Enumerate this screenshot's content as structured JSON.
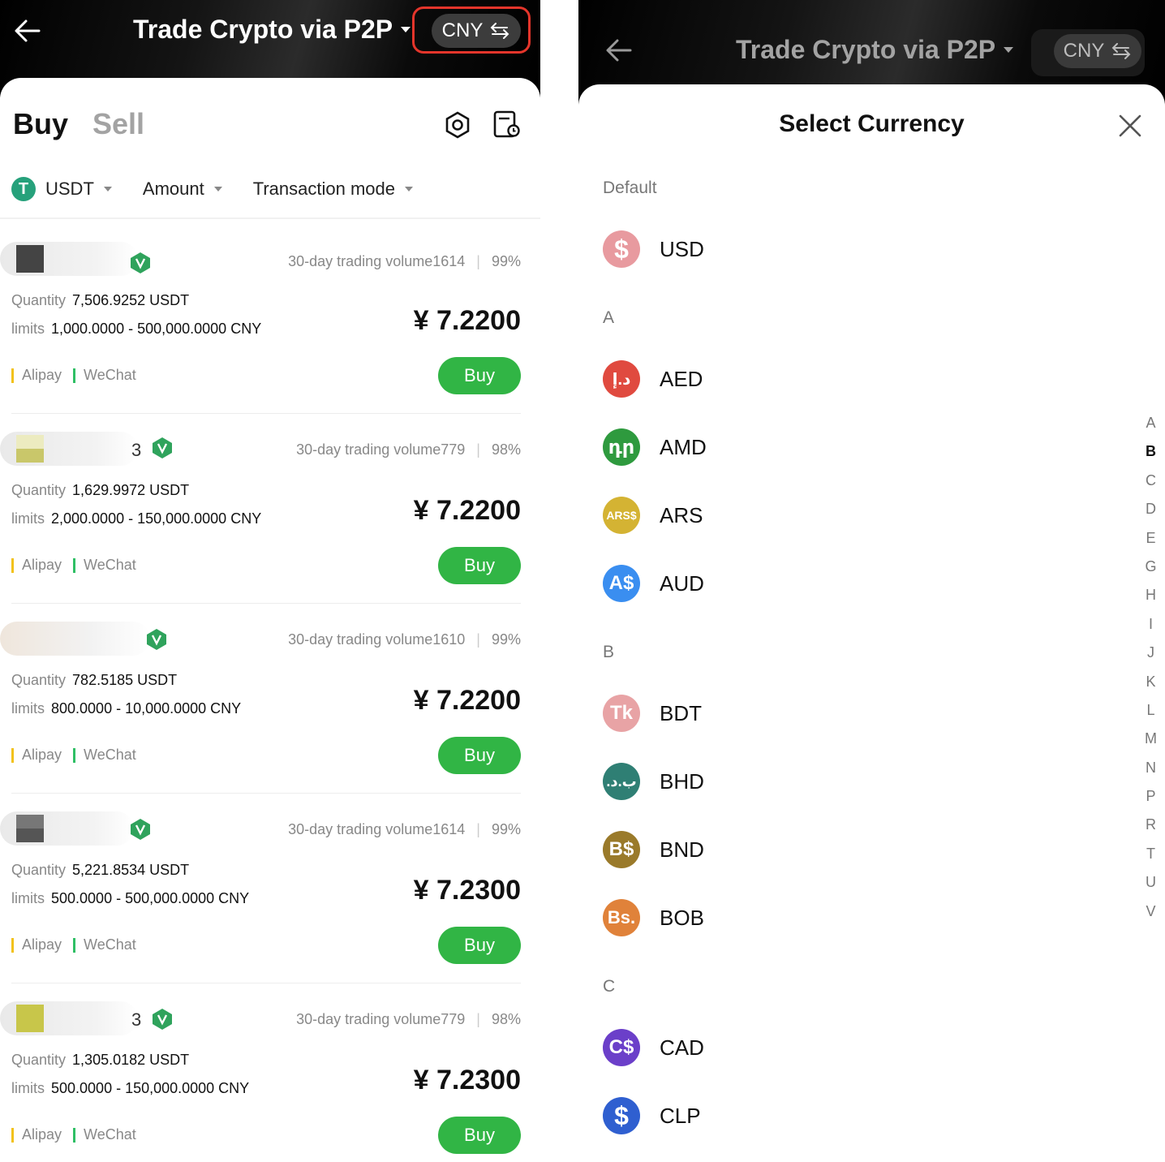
{
  "left": {
    "header": {
      "title": "Trade Crypto via P2P",
      "currency": "CNY"
    },
    "tabs": {
      "buy": "Buy",
      "sell": "Sell"
    },
    "filters": {
      "asset": "USDT",
      "amount": "Amount",
      "mode": "Transaction mode"
    },
    "offers": [
      {
        "avatar_color": "#444444",
        "initial": "",
        "volume": "30-day trading volume1614",
        "rate": "99%",
        "quantity_label": "Quantity",
        "quantity": "7,506.9252 USDT",
        "limits_label": "limits",
        "limits": "1,000.0000 - 500,000.0000 CNY",
        "price": "¥ 7.2200",
        "pay1": "Alipay",
        "pay2": "WeChat",
        "buy_label": "Buy"
      },
      {
        "avatar_color": "#d2d085",
        "initial": "3",
        "volume": "30-day trading volume779",
        "rate": "98%",
        "quantity_label": "Quantity",
        "quantity": "1,629.9972 USDT",
        "limits_label": "limits",
        "limits": "2,000.0000 - 150,000.0000 CNY",
        "price": "¥ 7.2200",
        "pay1": "Alipay",
        "pay2": "WeChat",
        "buy_label": "Buy"
      },
      {
        "avatar_color": "#efe6dc",
        "initial": "",
        "volume": "30-day trading volume1610",
        "rate": "99%",
        "quantity_label": "Quantity",
        "quantity": "782.5185 USDT",
        "limits_label": "limits",
        "limits": "800.0000 - 10,000.0000 CNY",
        "price": "¥ 7.2200",
        "pay1": "Alipay",
        "pay2": "WeChat",
        "buy_label": "Buy"
      },
      {
        "avatar_color": "#555555",
        "initial": "",
        "volume": "30-day trading volume1614",
        "rate": "99%",
        "quantity_label": "Quantity",
        "quantity": "5,221.8534 USDT",
        "limits_label": "limits",
        "limits": "500.0000 - 500,000.0000 CNY",
        "price": "¥ 7.2300",
        "pay1": "Alipay",
        "pay2": "WeChat",
        "buy_label": "Buy"
      },
      {
        "avatar_color": "#c8c64a",
        "initial": "3",
        "volume": "30-day trading volume779",
        "rate": "98%",
        "quantity_label": "Quantity",
        "quantity": "1,305.0182 USDT",
        "limits_label": "limits",
        "limits": "500.0000 - 150,000.0000 CNY",
        "price": "¥ 7.2300",
        "pay1": "Alipay",
        "pay2": "WeChat",
        "buy_label": "Buy"
      }
    ]
  },
  "right": {
    "header": {
      "title": "Trade Crypto via P2P",
      "currency": "CNY"
    },
    "sheet_title": "Select Currency",
    "sections": [
      {
        "label": "Default",
        "items": [
          {
            "code": "USD",
            "symbol": "$",
            "color": "#e89a9f"
          }
        ]
      },
      {
        "label": "A",
        "items": [
          {
            "code": "AED",
            "symbol": "د.إ",
            "color": "#e04a3f"
          },
          {
            "code": "AMD",
            "symbol": "դր",
            "color": "#2e9a3e"
          },
          {
            "code": "ARS",
            "symbol": "ARS$",
            "color": "#d4b333"
          },
          {
            "code": "AUD",
            "symbol": "A$",
            "color": "#3a8ef0"
          }
        ]
      },
      {
        "label": "B",
        "items": [
          {
            "code": "BDT",
            "symbol": "Tk",
            "color": "#e8a3a5"
          },
          {
            "code": "BHD",
            "symbol": ".ب.د",
            "color": "#2f7f74"
          },
          {
            "code": "BND",
            "symbol": "B$",
            "color": "#9a7a2a"
          },
          {
            "code": "BOB",
            "symbol": "Bs.",
            "color": "#e0823a"
          }
        ]
      },
      {
        "label": "C",
        "items": [
          {
            "code": "CAD",
            "symbol": "C$",
            "color": "#6b3fc9"
          },
          {
            "code": "CLP",
            "symbol": "$",
            "color": "#2f5fd0"
          }
        ]
      }
    ],
    "alphabet": [
      "A",
      "B",
      "C",
      "D",
      "E",
      "G",
      "H",
      "I",
      "J",
      "K",
      "L",
      "M",
      "N",
      "P",
      "R",
      "T",
      "U",
      "V"
    ],
    "alphabet_active": "B"
  },
  "colors": {
    "buy_green": "#31b545",
    "highlight_red": "#e4352b",
    "alipay_yellow": "#f2c21b",
    "wechat_green": "#2fbf65"
  }
}
